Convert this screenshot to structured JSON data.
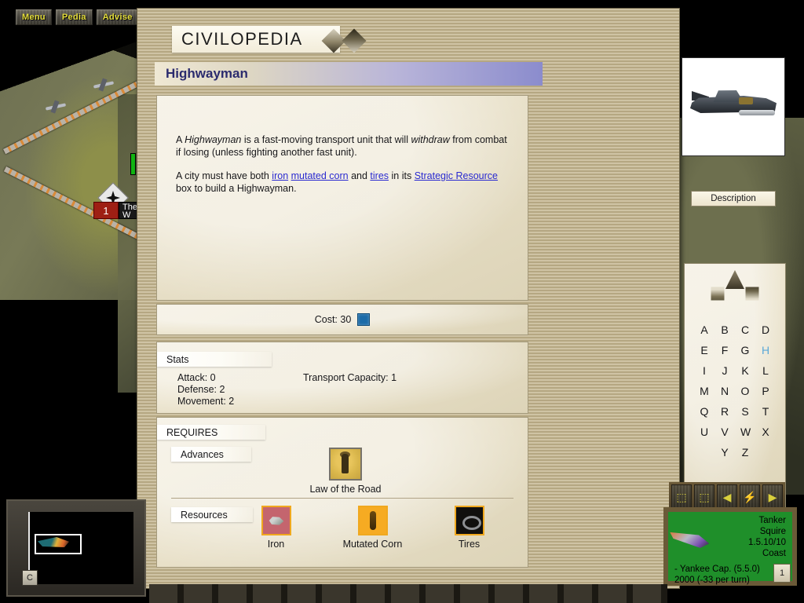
{
  "topbar": {
    "buttons": [
      {
        "label": "Menu",
        "name": "menu-button"
      },
      {
        "label": "Pedia",
        "name": "pedia-button"
      },
      {
        "label": "Advise",
        "name": "advise-button"
      }
    ]
  },
  "pedia": {
    "title": "CIVILOPEDIA",
    "entry_title": "Highwayman",
    "nav": {
      "back": "◀",
      "forward": "▶"
    },
    "description": {
      "para1_pre": "A ",
      "para1_italic1": "Highwayman",
      "para1_mid": " is a fast-moving transport unit that will ",
      "para1_italic2": "withdraw",
      "para1_post": " from combat if losing (unless fighting another fast unit).",
      "para2_pre": "A city must have both ",
      "link_iron": "iron",
      "link_corn": "mutated corn",
      "para2_and": " and ",
      "link_tires": "tires",
      "para2_mid": " in its ",
      "link_strategic": "Strategic Resource",
      "para2_post": " box to build a Highwayman."
    },
    "cost": {
      "label": "Cost: 30",
      "shield_color": "#1c6ba8"
    },
    "stats": {
      "section_label": "Stats",
      "attack": "Attack: 0",
      "defense": "Defense: 2",
      "movement": "Movement: 2",
      "transport": "Transport Capacity: 1"
    },
    "requires": {
      "section_label": "REQUIRES",
      "advances_label": "Advances",
      "advances": [
        {
          "name": "Law of the Road"
        }
      ],
      "resources_label": "Resources",
      "resources": [
        {
          "name": "Iron",
          "icon": "iron-ore-icon"
        },
        {
          "name": "Mutated Corn",
          "icon": "mutated-corn-icon"
        },
        {
          "name": "Tires",
          "icon": "tires-icon"
        }
      ]
    },
    "unit_image_alt": "highwayman-car-image",
    "description_button": "Description",
    "alphabet": {
      "rows": [
        [
          "A",
          "B",
          "C",
          "D"
        ],
        [
          "E",
          "F",
          "G",
          "H"
        ],
        [
          "I",
          "J",
          "K",
          "L"
        ],
        [
          "M",
          "N",
          "O",
          "P"
        ],
        [
          "Q",
          "R",
          "S",
          "T"
        ],
        [
          "U",
          "V",
          "W",
          "X"
        ],
        [
          "Y",
          "Z"
        ]
      ],
      "selected": "H",
      "selected_color": "#5aa8d8"
    }
  },
  "map": {
    "city": {
      "population": "1",
      "name_line1": "The",
      "name_line2": "W"
    }
  },
  "hud": {
    "unit_name": "Tanker",
    "unit_owner": "Squire",
    "unit_stats": "1.5.10/10",
    "unit_terrain": "Coast",
    "civ_line": "- Yankee Cap. (5.5.0)",
    "treasury_line": "2000  (-33 per turn)",
    "corner_label": "1",
    "tools": [
      "⬚",
      "⬚",
      "◀",
      "⚡",
      "▶"
    ]
  },
  "minimap": {
    "corner_label": "C"
  }
}
